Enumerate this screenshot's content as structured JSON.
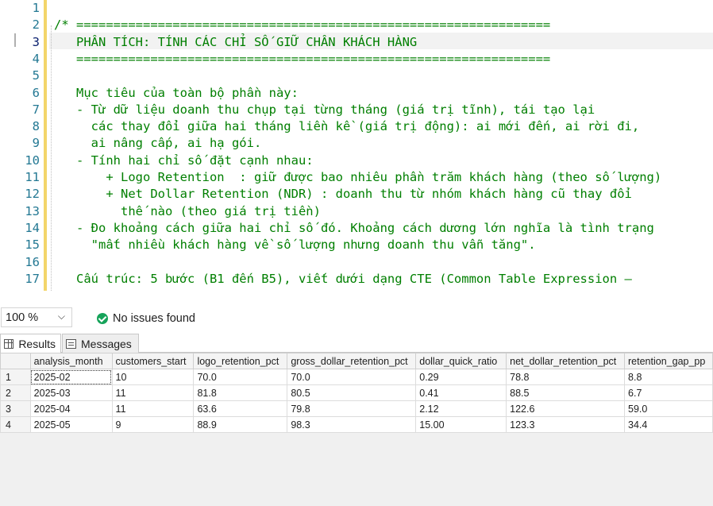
{
  "editor": {
    "line_numbers": [
      "1",
      "2",
      "3",
      "4",
      "5",
      "6",
      "7",
      "8",
      "9",
      "10",
      "11",
      "12",
      "13",
      "14",
      "15",
      "16",
      "17"
    ],
    "lines": [
      "",
      "/* ================================================================",
      "   PHÂN TÍCH: TÍNH CÁC CHỈ SỐ GIỮ CHÂN KHÁCH HÀNG",
      "   ================================================================",
      "",
      "   Mục tiêu của toàn bộ phần này:",
      "   - Từ dữ liệu doanh thu chụp tại từng tháng (giá trị tĩnh), tái tạo lại",
      "     các thay đổi giữa hai tháng liền kề (giá trị động): ai mới đến, ai rời đi,",
      "     ai nâng cấp, ai hạ gói.",
      "   - Tính hai chỉ số đặt cạnh nhau:",
      "       + Logo Retention  : giữ được bao nhiêu phần trăm khách hàng (theo số lượng)",
      "       + Net Dollar Retention (NDR) : doanh thu từ nhóm khách hàng cũ thay đổi",
      "         thế nào (theo giá trị tiền)",
      "   - Đo khoảng cách giữa hai chỉ số đó. Khoảng cách dương lớn nghĩa là tình trạng",
      "     \"mất nhiều khách hàng về số lượng nhưng doanh thu vẫn tăng\".",
      "",
      "   Cấu trúc: 5 bước (B1 đến B5), viết dưới dạng CTE (Common Table Expression —"
    ]
  },
  "status": {
    "zoom": "100 %",
    "issues_text": "No issues found"
  },
  "tabs": {
    "results": "Results",
    "messages": "Messages"
  },
  "grid": {
    "headers": [
      "analysis_month",
      "customers_start",
      "logo_retention_pct",
      "gross_dollar_retention_pct",
      "dollar_quick_ratio",
      "net_dollar_retention_pct",
      "retention_gap_pp"
    ],
    "rows": [
      {
        "n": "1",
        "cells": [
          "2025-02",
          "10",
          "70.0",
          "70.0",
          "0.29",
          "78.8",
          "8.8"
        ]
      },
      {
        "n": "2",
        "cells": [
          "2025-03",
          "11",
          "81.8",
          "80.5",
          "0.41",
          "88.5",
          "6.7"
        ]
      },
      {
        "n": "3",
        "cells": [
          "2025-04",
          "11",
          "63.6",
          "79.8",
          "2.12",
          "122.6",
          "59.0"
        ]
      },
      {
        "n": "4",
        "cells": [
          "2025-05",
          "9",
          "88.9",
          "98.3",
          "15.00",
          "123.3",
          "34.4"
        ]
      }
    ]
  }
}
